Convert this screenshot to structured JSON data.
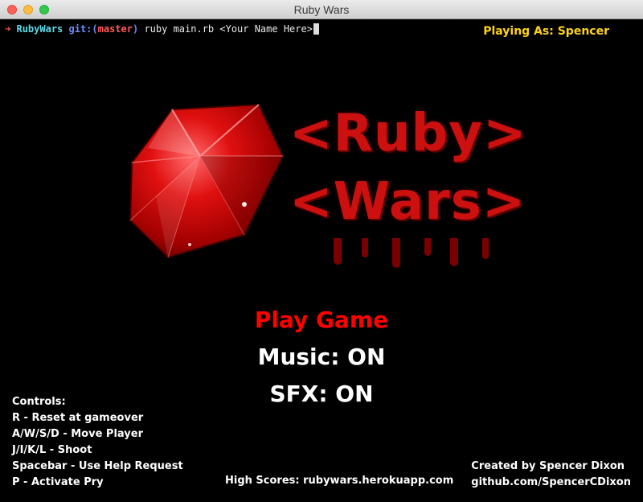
{
  "window": {
    "title": "Ruby Wars"
  },
  "terminal": {
    "prompt_arrow": "➜",
    "prompt_dir": "RubyWars",
    "prompt_git": "git:(",
    "prompt_branch": "master",
    "prompt_git_close": ")",
    "command": " ruby main.rb <Your Name Here>"
  },
  "header": {
    "playing_as": "Playing As: Spencer"
  },
  "logo": {
    "line1": "<Ruby>",
    "line2": "<Wars>"
  },
  "menu": {
    "play": "Play Game",
    "music": "Music: ON",
    "sfx": "SFX: ON"
  },
  "controls": {
    "title": "Controls:",
    "items": [
      "R - Reset at gameover",
      "A/W/S/D - Move Player",
      "J/I/K/L - Shoot",
      "Spacebar - Use Help Request",
      "P - Activate Pry"
    ]
  },
  "footer": {
    "high_scores": "High Scores: rubywars.herokuapp.com",
    "credit": "Created by Spencer Dixon",
    "github": "github.com/SpencerCDixon"
  },
  "colors": {
    "accent": "#ff0000",
    "playing": "#ffd21a",
    "logo": "#cc1010"
  }
}
